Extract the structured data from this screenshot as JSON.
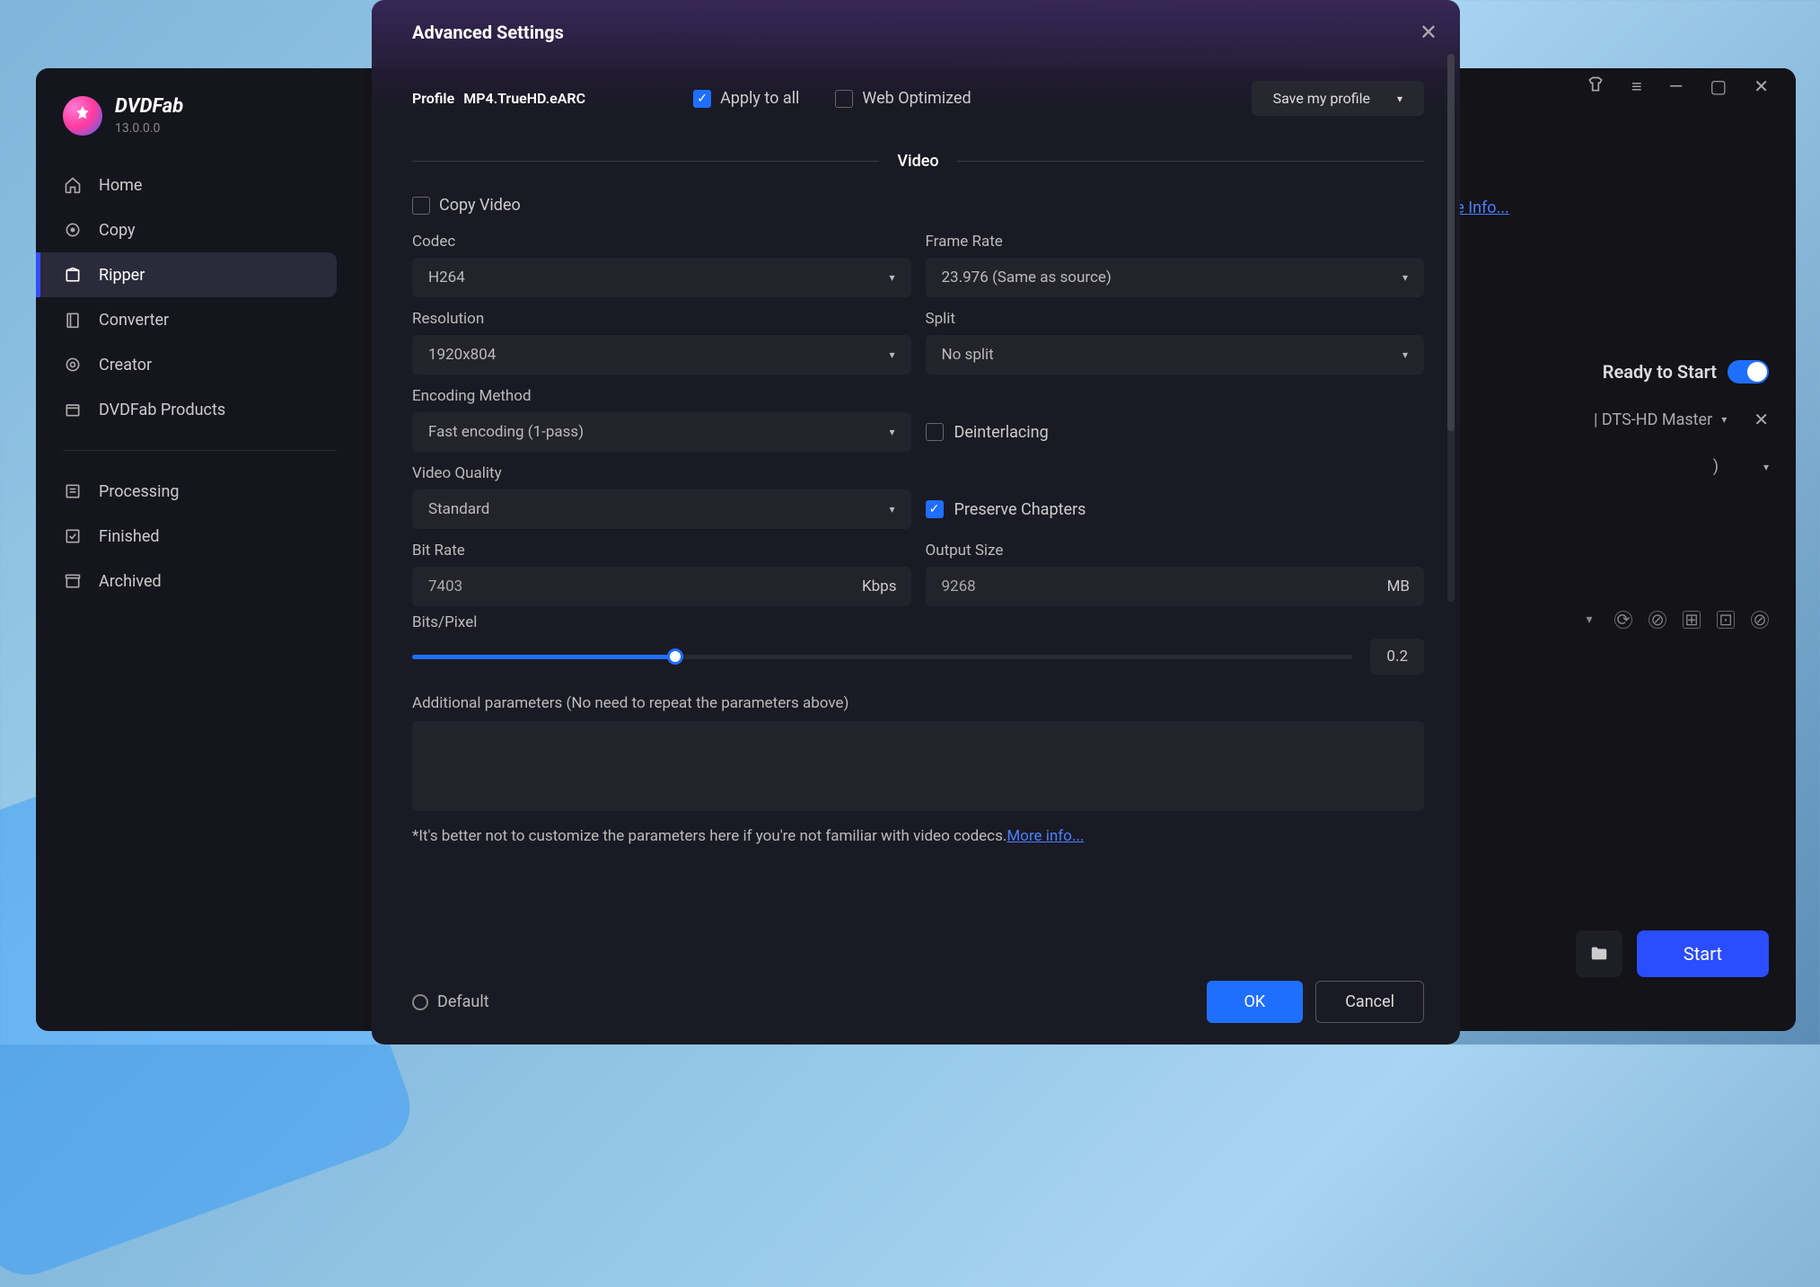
{
  "app": {
    "brand": "DVDFab",
    "version": "13.0.0.0"
  },
  "sidebar": {
    "items": [
      {
        "label": "Home"
      },
      {
        "label": "Copy"
      },
      {
        "label": "Ripper"
      },
      {
        "label": "Converter"
      },
      {
        "label": "Creator"
      },
      {
        "label": "DVDFab Products"
      }
    ],
    "bottom": [
      {
        "label": "Processing"
      },
      {
        "label": "Finished"
      },
      {
        "label": "Archived"
      }
    ]
  },
  "background": {
    "more_info": "ore Info...",
    "ready": "Ready to Start",
    "audio_hint": " | DTS-HD Master",
    "paren": ")",
    "start": "Start"
  },
  "modal": {
    "title": "Advanced Settings",
    "profile_label": "Profile",
    "profile_value": "MP4.TrueHD.eARC",
    "apply_all": "Apply to all",
    "web_optimized": "Web Optimized",
    "save_profile": "Save my profile",
    "section_video": "Video",
    "copy_video": "Copy Video",
    "fields": {
      "codec_label": "Codec",
      "codec_value": "H264",
      "framerate_label": "Frame Rate",
      "framerate_value": "23.976 (Same as source)",
      "resolution_label": "Resolution",
      "resolution_value": "1920x804",
      "split_label": "Split",
      "split_value": "No split",
      "encoding_label": "Encoding Method",
      "encoding_value": "Fast encoding (1-pass)",
      "deinterlacing": "Deinterlacing",
      "quality_label": "Video Quality",
      "quality_value": "Standard",
      "preserve_chapters": "Preserve Chapters",
      "bitrate_label": "Bit Rate",
      "bitrate_value": "7403",
      "bitrate_unit": "Kbps",
      "output_label": "Output Size",
      "output_value": "9268",
      "output_unit": "MB",
      "bitspixel_label": "Bits/Pixel",
      "bitspixel_value": "0.2",
      "addparams_label": "Additional parameters (No need to repeat the parameters above)"
    },
    "footnote_text": "*It's better not to customize the parameters here if you're not familiar with video codecs.",
    "footnote_link": "More info...",
    "default_label": "Default",
    "ok": "OK",
    "cancel": "Cancel"
  }
}
